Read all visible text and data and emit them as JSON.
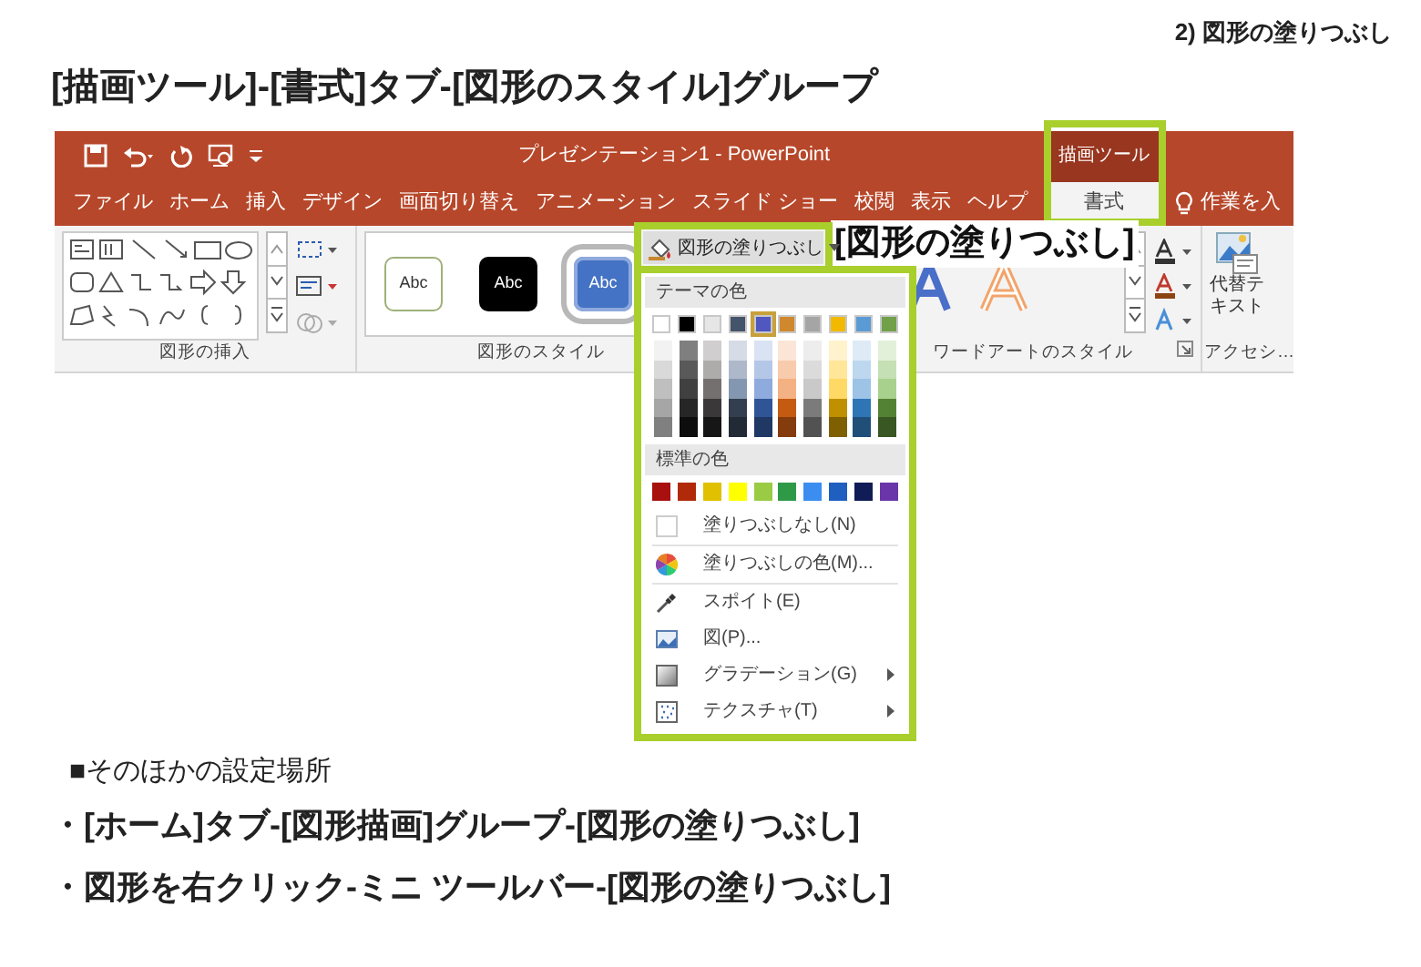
{
  "section_label": "2) 図形の塗りつぶし",
  "heading": "[描画ツール]-[書式]タブ-[図形のスタイル]グループ",
  "app": {
    "title": "プレゼンテーション1 - PowerPoint",
    "contextual_group": "描画ツール",
    "tabs": [
      {
        "label": "ファイル",
        "selected": false,
        "kind": "main"
      },
      {
        "label": "ホーム",
        "selected": false,
        "kind": "main"
      },
      {
        "label": "挿入",
        "selected": false,
        "kind": "main"
      },
      {
        "label": "デザイン",
        "selected": false,
        "kind": "main"
      },
      {
        "label": "画面切り替え",
        "selected": false,
        "kind": "main"
      },
      {
        "label": "アニメーション",
        "selected": false,
        "kind": "main"
      },
      {
        "label": "スライド ショー",
        "selected": false,
        "kind": "main"
      },
      {
        "label": "校閲",
        "selected": false,
        "kind": "main"
      },
      {
        "label": "表示",
        "selected": false,
        "kind": "main"
      },
      {
        "label": "ヘルプ",
        "selected": false,
        "kind": "main"
      },
      {
        "label": "書式",
        "selected": true,
        "kind": "contextual"
      }
    ],
    "tell_me": "作業を入",
    "ribbon": {
      "insert_shapes_group": {
        "label": "図形の挿入"
      },
      "shape_styles_group": {
        "label": "図形のスタイル",
        "style_presets": [
          {
            "label": "Abc",
            "kind": "outline",
            "selected": false
          },
          {
            "label": "Abc",
            "kind": "dark",
            "selected": false
          },
          {
            "label": "Abc",
            "kind": "blue",
            "selected": true
          }
        ],
        "fill_button": "図形の塗りつぶし"
      },
      "wordart_group": {
        "label": "ワードアートのスタイル"
      },
      "accessibility_group": {
        "label": "アクセシ…",
        "alt_text_button": "代替テキスト"
      }
    }
  },
  "callout": "[図形の塗りつぶし]",
  "fill_menu": {
    "theme_header": "テーマの色",
    "theme_colors": [
      {
        "color": "#ffffff",
        "selected": false,
        "shades": [
          {
            "color": "#f2f2f2"
          },
          {
            "color": "#d9d9d9"
          },
          {
            "color": "#bfbfbf"
          },
          {
            "color": "#a6a6a6"
          },
          {
            "color": "#808080"
          }
        ]
      },
      {
        "color": "#000000",
        "selected": false,
        "shades": [
          {
            "color": "#7f7f7f"
          },
          {
            "color": "#595959"
          },
          {
            "color": "#404040"
          },
          {
            "color": "#262626"
          },
          {
            "color": "#0d0d0d"
          }
        ]
      },
      {
        "color": "#e7e6e6",
        "selected": false,
        "shades": [
          {
            "color": "#d0cece"
          },
          {
            "color": "#aeabab"
          },
          {
            "color": "#757070"
          },
          {
            "color": "#3a3838"
          },
          {
            "color": "#171616"
          }
        ]
      },
      {
        "color": "#44546a",
        "selected": false,
        "shades": [
          {
            "color": "#d6dce5"
          },
          {
            "color": "#adb9ca"
          },
          {
            "color": "#8497b0"
          },
          {
            "color": "#333f50"
          },
          {
            "color": "#222a35"
          }
        ]
      },
      {
        "color": "#5058c0",
        "selected": true,
        "shades": [
          {
            "color": "#dae3f3"
          },
          {
            "color": "#b4c7e7"
          },
          {
            "color": "#8faadc"
          },
          {
            "color": "#2f5597"
          },
          {
            "color": "#203864"
          }
        ]
      },
      {
        "color": "#d0882e",
        "selected": false,
        "shades": [
          {
            "color": "#fbe5d6"
          },
          {
            "color": "#f8cbad"
          },
          {
            "color": "#f4b183"
          },
          {
            "color": "#c55a11"
          },
          {
            "color": "#843c0c"
          }
        ]
      },
      {
        "color": "#a5a5a5",
        "selected": false,
        "shades": [
          {
            "color": "#ededed"
          },
          {
            "color": "#dbdbdb"
          },
          {
            "color": "#c9c9c9"
          },
          {
            "color": "#7b7b7b"
          },
          {
            "color": "#525252"
          }
        ]
      },
      {
        "color": "#f2b900",
        "selected": false,
        "shades": [
          {
            "color": "#fff2cc"
          },
          {
            "color": "#ffe699"
          },
          {
            "color": "#ffd966"
          },
          {
            "color": "#bf9000"
          },
          {
            "color": "#7f6000"
          }
        ]
      },
      {
        "color": "#5b9bd5",
        "selected": false,
        "shades": [
          {
            "color": "#deebf7"
          },
          {
            "color": "#bdd7ee"
          },
          {
            "color": "#9dc3e6"
          },
          {
            "color": "#2e75b6"
          },
          {
            "color": "#1f4e79"
          }
        ]
      },
      {
        "color": "#70a047",
        "selected": false,
        "shades": [
          {
            "color": "#e2f0d9"
          },
          {
            "color": "#c5e0b4"
          },
          {
            "color": "#a9d18e"
          },
          {
            "color": "#548235"
          },
          {
            "color": "#385723"
          }
        ]
      }
    ],
    "standard_header": "標準の色",
    "standard_colors": [
      {
        "color": "#a80f0f",
        "selected": false
      },
      {
        "color": "#b02a0a",
        "selected": false
      },
      {
        "color": "#e0c000",
        "selected": false
      },
      {
        "color": "#ffff00",
        "selected": false
      },
      {
        "color": "#99cc44",
        "selected": false
      },
      {
        "color": "#2e9a48",
        "selected": false
      },
      {
        "color": "#3b8ef0",
        "selected": false
      },
      {
        "color": "#1f5fc0",
        "selected": false
      },
      {
        "color": "#101c55",
        "selected": false
      },
      {
        "color": "#6a35a8",
        "selected": false
      }
    ],
    "items": [
      {
        "label": "塗りつぶしなし(N)",
        "kind": "none",
        "submenu": false
      },
      {
        "label": "塗りつぶしの色(M)...",
        "kind": "color",
        "submenu": false
      },
      {
        "label": "スポイト(E)",
        "kind": "eyedropper",
        "submenu": false
      },
      {
        "label": "図(P)...",
        "kind": "picture",
        "submenu": false
      },
      {
        "label": "グラデーション(G)",
        "kind": "gradient",
        "submenu": true
      },
      {
        "label": "テクスチャ(T)",
        "kind": "texture",
        "submenu": true
      }
    ]
  },
  "other_locations": {
    "title": "■そのほかの設定場所",
    "items": [
      "・[ホーム]タブ-[図形描画]グループ-[図形の塗りつぶし]",
      "・図形を右クリック-ミニ ツールバー-[図形の塗りつぶし]"
    ]
  }
}
